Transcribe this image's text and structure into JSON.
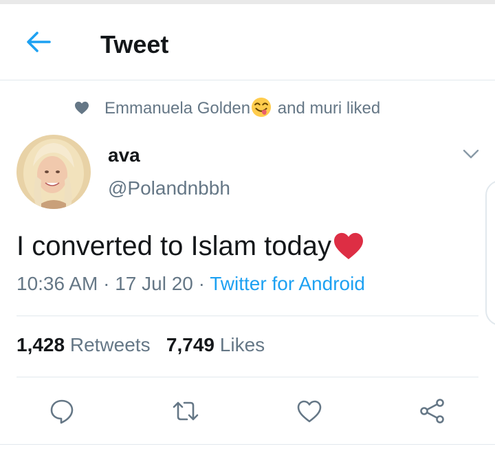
{
  "header": {
    "title": "Tweet",
    "back_icon": "back-arrow-icon"
  },
  "social_context": {
    "liker_name": "Emmanuela Golden",
    "liker_emoji": "yum-face-emoji",
    "suffix": "and muri liked"
  },
  "tweet": {
    "author_name": "ava",
    "author_handle": "@Polandnbbh",
    "text": "I converted to Islam today",
    "text_emoji": "red-heart-emoji",
    "time": "10:36 AM",
    "date": "17 Jul 20",
    "source": "Twitter for Android",
    "separator": "·"
  },
  "stats": {
    "retweets_count": "1,428",
    "retweets_label": "Retweets",
    "likes_count": "7,749",
    "likes_label": "Likes"
  },
  "actions": [
    "reply-icon",
    "retweet-icon",
    "like-icon",
    "share-icon"
  ],
  "colors": {
    "accent": "#1da1f2",
    "text_primary": "#14171a",
    "text_secondary": "#657786",
    "divider": "#e1e8ed",
    "heart": "#e0245e"
  }
}
